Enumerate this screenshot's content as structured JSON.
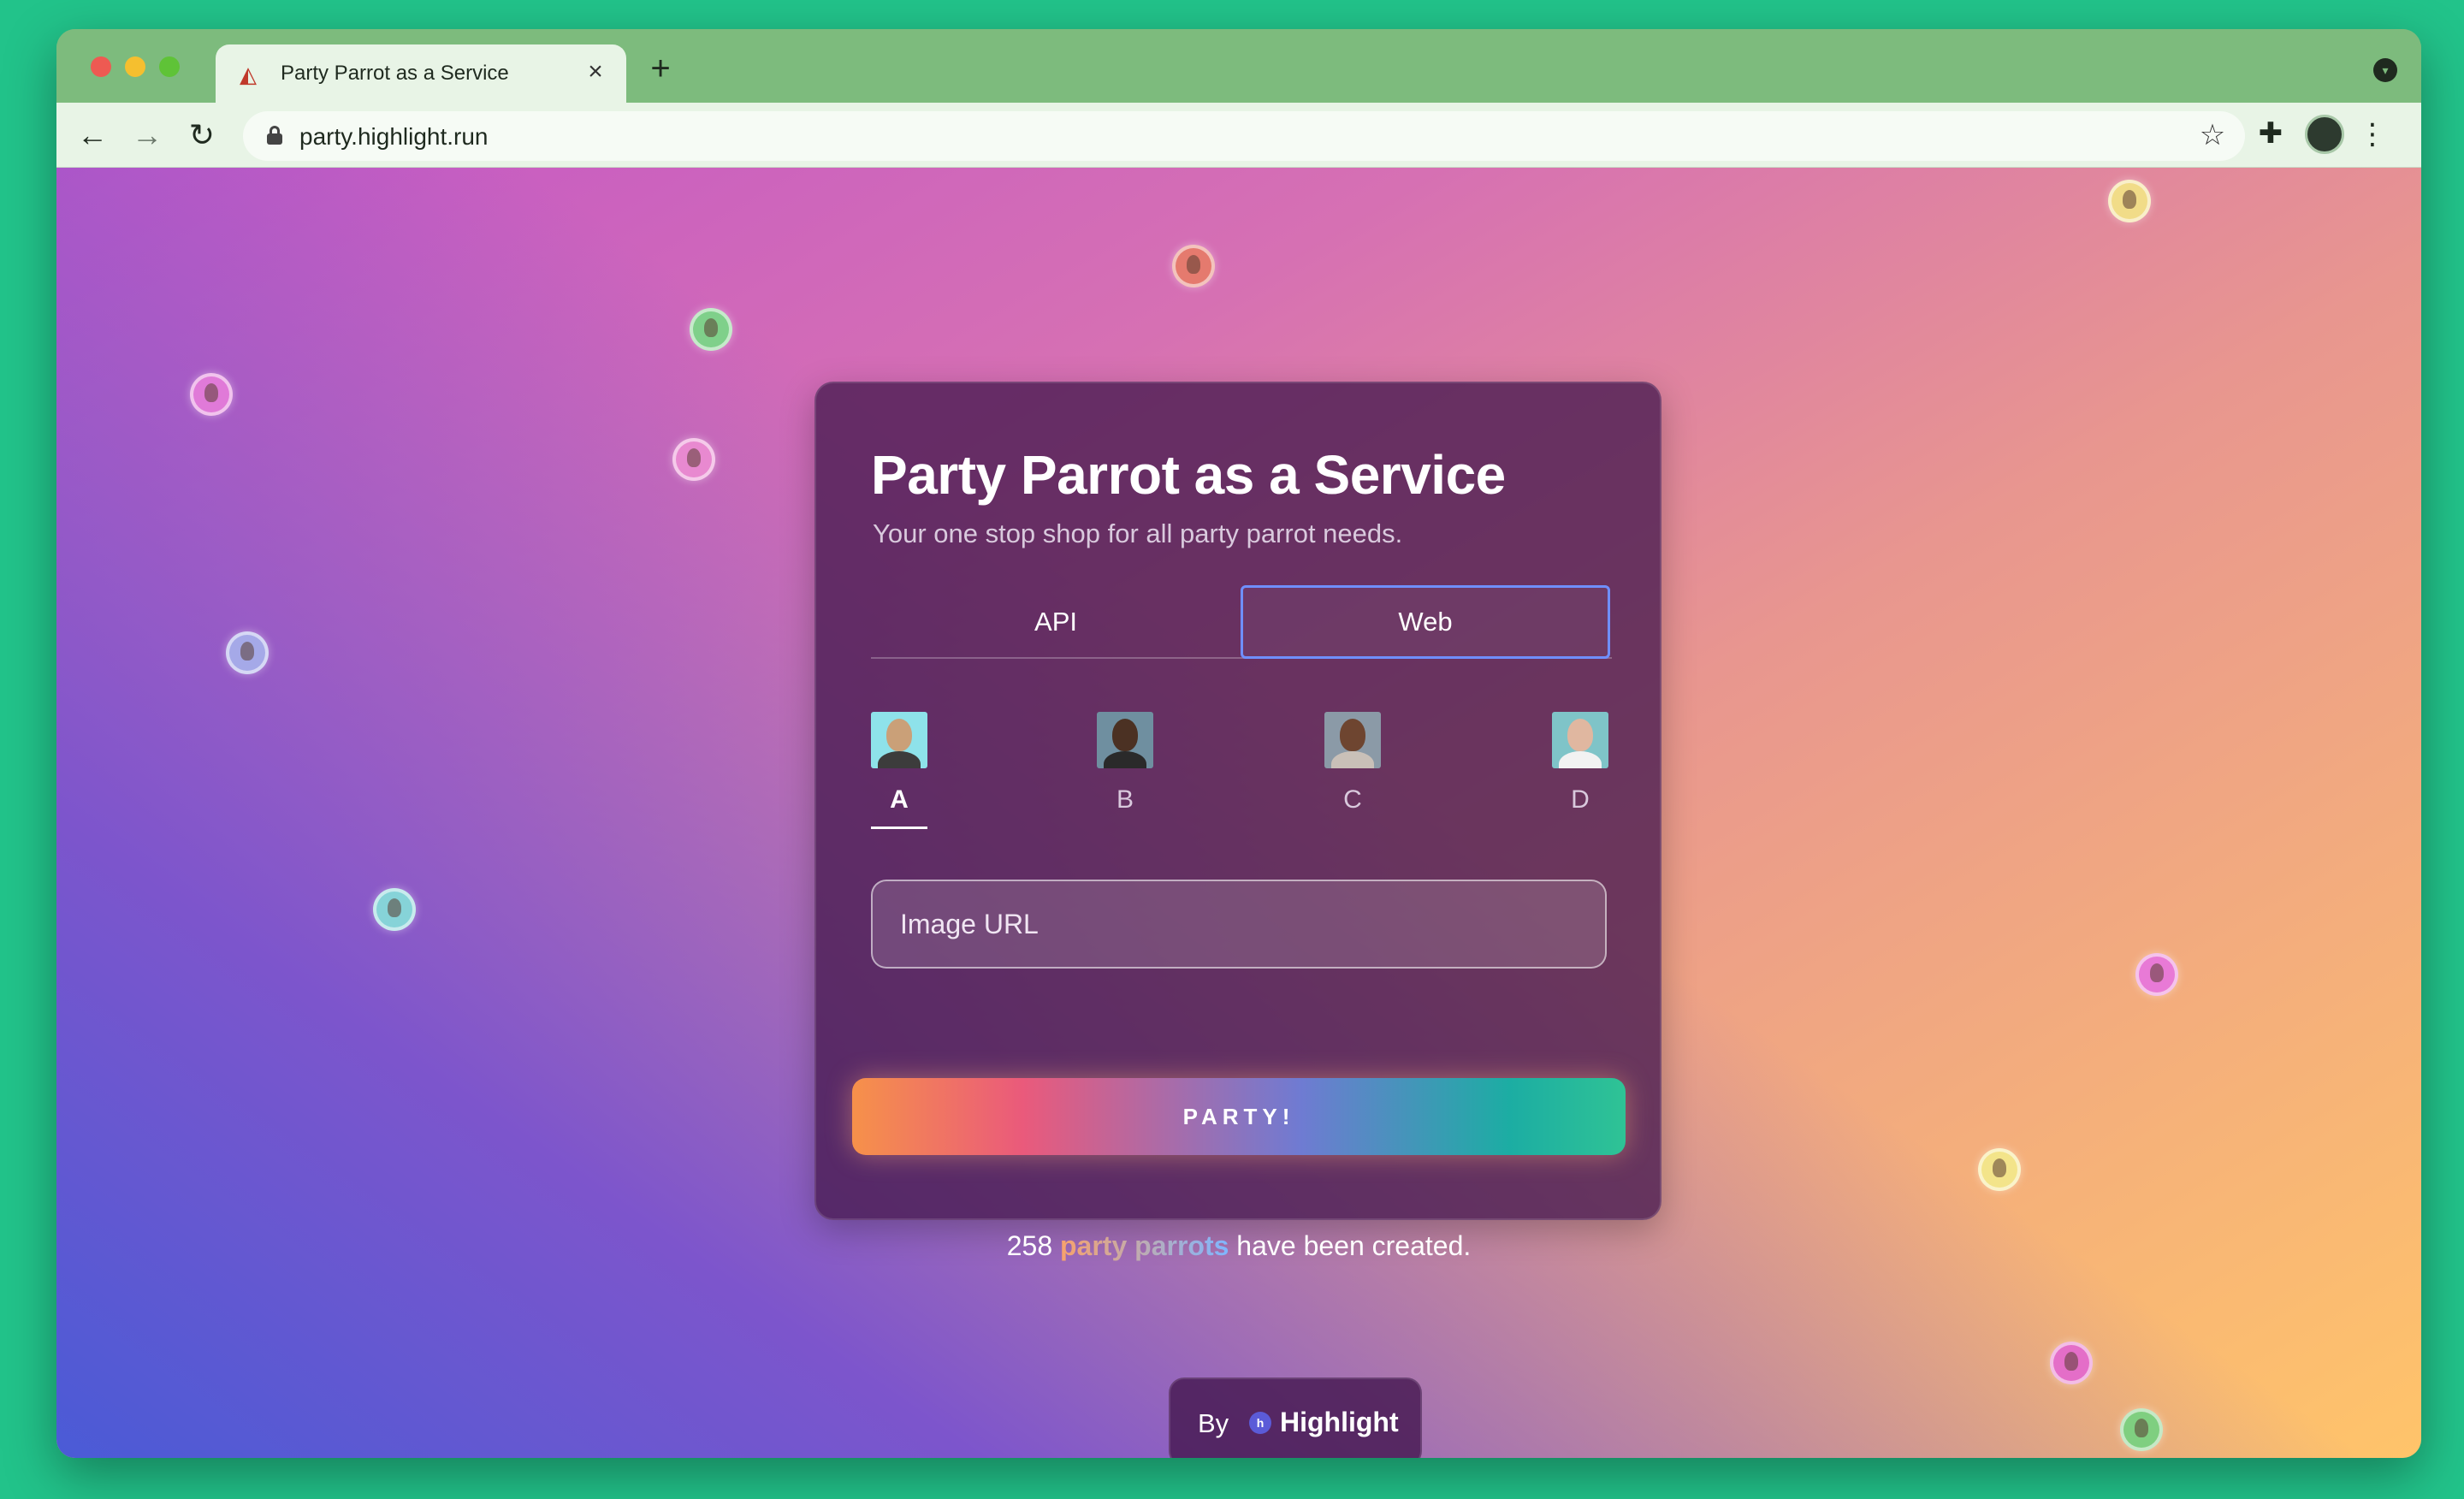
{
  "browser": {
    "tab_title": "Party Parrot as a Service",
    "tab_close": "×",
    "new_tab": "+",
    "url": "party.highlight.run",
    "icons": {
      "back": "←",
      "forward": "→",
      "reload": "↻",
      "star": "☆",
      "extensions": "✚",
      "menu": "⋮",
      "tab_menu": "▾",
      "favicon": "◭"
    }
  },
  "card": {
    "title": "Party Parrot as a Service",
    "subtitle": "Your one stop shop for all party parrot needs.",
    "tabs": [
      {
        "label": "API",
        "active": false
      },
      {
        "label": "Web",
        "active": true
      }
    ],
    "presets": [
      {
        "label": "A",
        "active": true
      },
      {
        "label": "B",
        "active": false
      },
      {
        "label": "C",
        "active": false
      },
      {
        "label": "D",
        "active": false
      }
    ],
    "image_url_placeholder": "Image URL",
    "party_button": "PARTY!"
  },
  "counter": {
    "count": "258",
    "highlight": "party parrots",
    "suffix": "have been created."
  },
  "footer": {
    "by": "By",
    "brand": "Highlight",
    "logo_glyph": "h"
  },
  "colors": {
    "accent_blue": "#6f8fff",
    "card_bg": "#46194f",
    "browser_green": "#7dbb7d"
  }
}
